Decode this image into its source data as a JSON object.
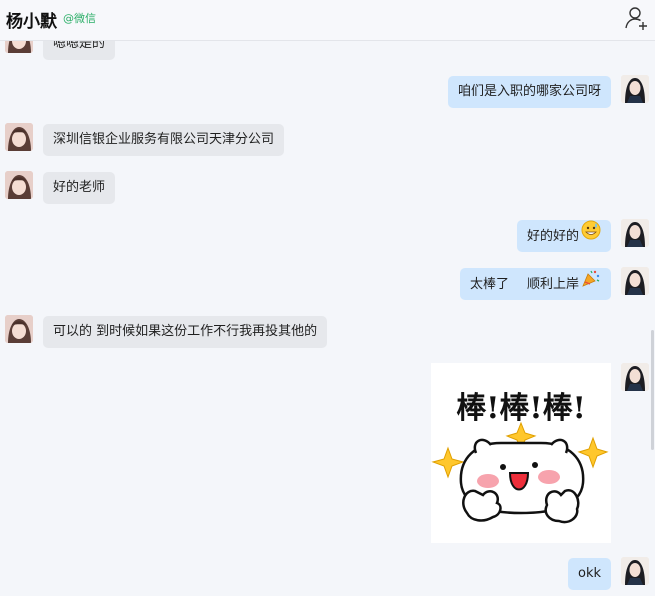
{
  "header": {
    "contact_name": "杨小默",
    "contact_source": "@微信",
    "add_icon": "add-contact-icon"
  },
  "messages": [
    {
      "from": "friend",
      "text": "嗯嗯是的"
    },
    {
      "from": "me",
      "text": "咱们是入职的哪家公司呀"
    },
    {
      "from": "friend",
      "text": "深圳信银企业服务有限公司天津分公司"
    },
    {
      "from": "friend",
      "text": "好的老师"
    },
    {
      "from": "me",
      "text": "好的好的",
      "emoji": "grinning-sweat-emoji"
    },
    {
      "from": "me",
      "text_a": "太棒了",
      "text_b": "顺利上岸",
      "emoji": "party-popper-emoji"
    },
    {
      "from": "friend",
      "text": "可以的 到时候如果这份工作不行我再投其他的"
    },
    {
      "from": "me",
      "sticker_text": "棒!棒!棒!",
      "sticker": "thumbs-up-bunny-sticker"
    },
    {
      "from": "me",
      "text": "okk"
    }
  ],
  "colors": {
    "friend_bubble": "#e6e8ec",
    "my_bubble": "#cfe6fd",
    "source_green": "#2aae67",
    "background": "#f4f6fa"
  }
}
